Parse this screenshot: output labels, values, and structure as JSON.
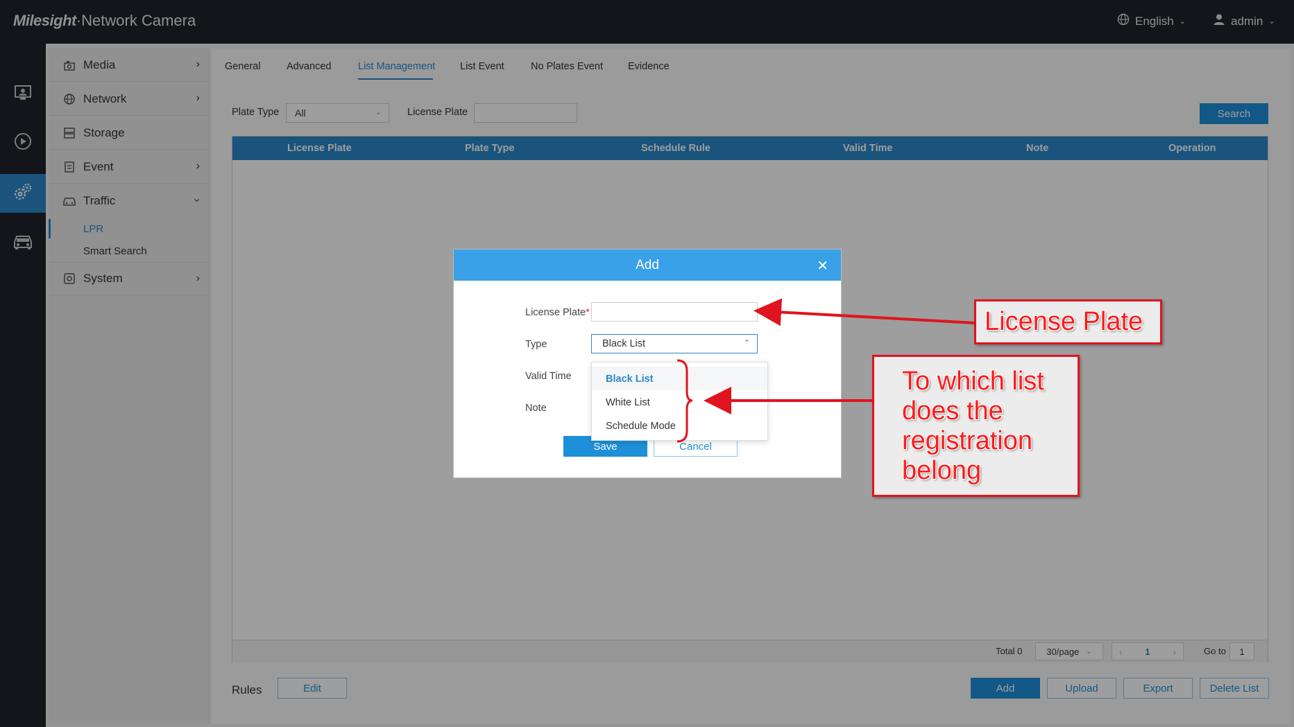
{
  "header": {
    "brand_logo": "Milesight",
    "brand_product": "·Network Camera",
    "language": "English",
    "user": "admin"
  },
  "rail": {
    "items": [
      "live-view-icon",
      "playback-icon",
      "settings-icon",
      "vehicle-icon"
    ]
  },
  "sidebar": {
    "items": [
      {
        "label": "Media"
      },
      {
        "label": "Network"
      },
      {
        "label": "Storage"
      },
      {
        "label": "Event"
      },
      {
        "label": "Traffic"
      },
      {
        "label": "System"
      }
    ],
    "traffic_sub": [
      "LPR",
      "Smart Search"
    ]
  },
  "tabs": [
    "General",
    "Advanced",
    "List Management",
    "List Event",
    "No Plates Event",
    "Evidence"
  ],
  "filters": {
    "plate_type_label": "Plate Type",
    "plate_type_value": "All",
    "license_plate_label": "License Plate",
    "search_button": "Search"
  },
  "table": {
    "columns": [
      "License Plate",
      "Plate Type",
      "Schedule Rule",
      "Valid Time",
      "Note",
      "Operation"
    ]
  },
  "pagination": {
    "total": "Total 0",
    "per_page": "30/page",
    "page": "1",
    "goto_label": "Go to",
    "goto_value": "1"
  },
  "footer": {
    "rules_label": "Rules",
    "edit_button": "Edit",
    "add_button": "Add",
    "upload_button": "Upload",
    "export_button": "Export",
    "delete_button": "Delete List"
  },
  "modal": {
    "title": "Add",
    "license_plate_label": "License Plate",
    "required_mark": "*",
    "type_label": "Type",
    "type_value": "Black List",
    "valid_time_label": "Valid Time",
    "note_label": "Note",
    "save_button": "Save",
    "cancel_button": "Cancel",
    "type_options": [
      "Black List",
      "White List",
      "Schedule Mode"
    ]
  },
  "annotations": {
    "callout_1": "License Plate",
    "callout_2": [
      "To which list",
      "does the",
      "registration",
      "belong"
    ]
  },
  "colors": {
    "accent": "#2b87c9",
    "header_bg": "#20222a",
    "annotation_red": "#e0141e"
  }
}
